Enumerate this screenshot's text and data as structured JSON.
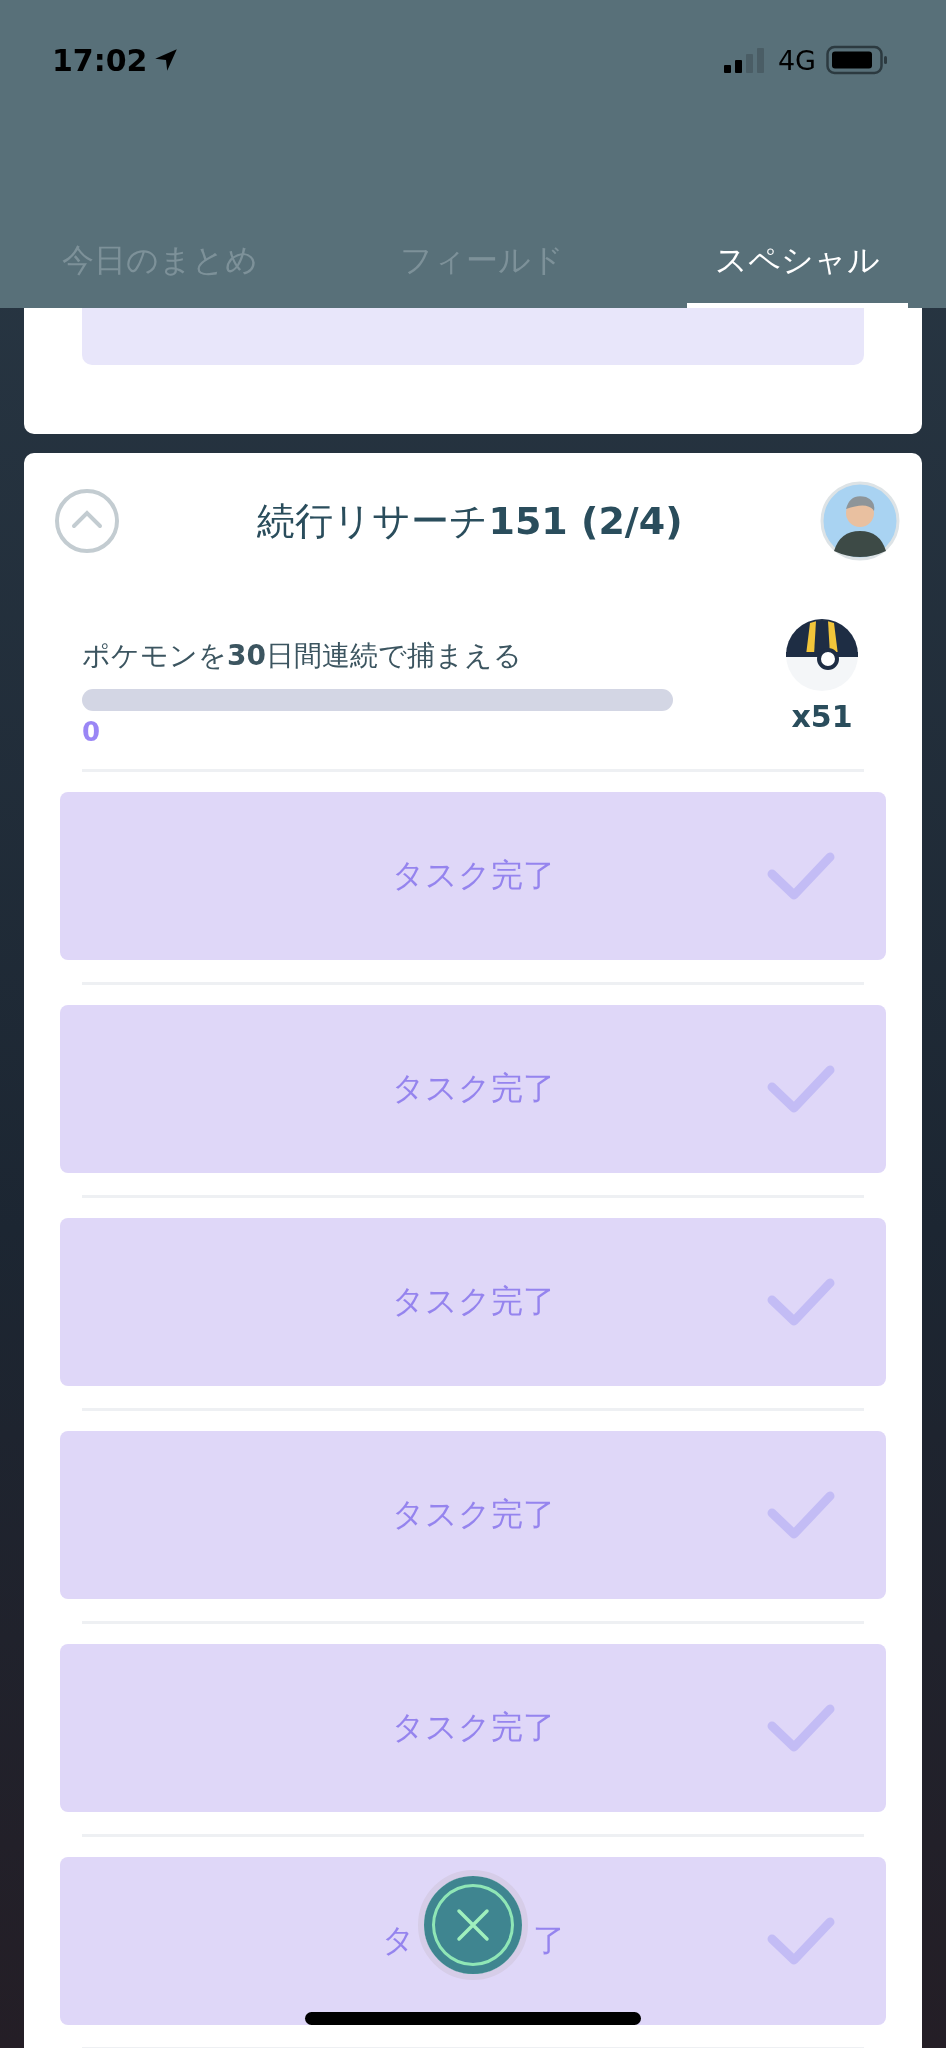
{
  "status_bar": {
    "time": "17:02",
    "network": "4G"
  },
  "tabs": [
    {
      "label": "今日のまとめ",
      "selected": false
    },
    {
      "label": "フィールド",
      "selected": false
    },
    {
      "label": "スペシャル",
      "selected": true
    }
  ],
  "research": {
    "title": "続行リサーチ**151 (2/4)**",
    "expanded": true,
    "task": {
      "text": "ポケモンを**30**日間連続で捕まえる",
      "level": 0,
      "progress_label": "0",
      "reward_count": "x51"
    },
    "steps": [
      {
        "label": "タスク完了",
        "done": true
      },
      {
        "label": "タスク完了",
        "done": true
      },
      {
        "label": "タスク完了",
        "done": true
      },
      {
        "label": "タスク完了",
        "done": true
      },
      {
        "label": "タスク完了",
        "done": true
      },
      {
        "kind": "covered",
        "parts": [
          "タ",
          "了"
        ],
        "done": true
      }
    ]
  }
}
